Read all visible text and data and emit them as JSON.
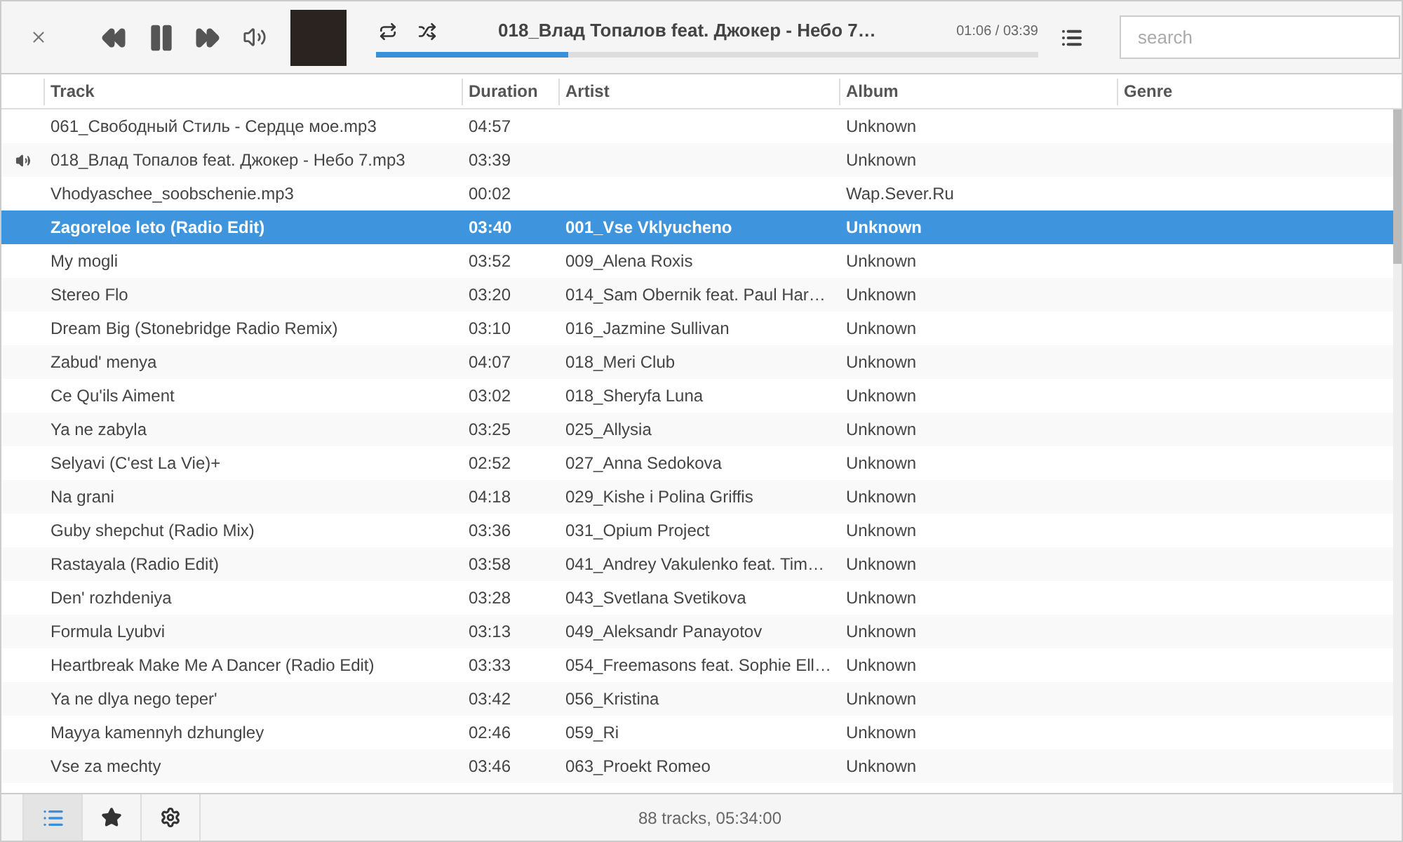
{
  "player": {
    "now_playing": "018_Влад Топалов feat. Джокер - Небо 7…",
    "time": "01:06 / 03:39",
    "level": 0.29,
    "search": {
      "placeholder": "search"
    }
  },
  "table": {
    "columns": [
      "Track",
      "Duration",
      "Artist",
      "Album",
      "Genre"
    ],
    "rows": [
      {
        "track": "061_Свободный Стиль - Сердце мое.mp3",
        "duration": "04:57",
        "artist": "",
        "album": "Unknown",
        "playing": false,
        "selected": false
      },
      {
        "track": "018_Влад Топалов feat. Джокер - Небо 7.mp3",
        "duration": "03:39",
        "artist": "",
        "album": "Unknown",
        "playing": true,
        "selected": false
      },
      {
        "track": "Vhodyaschee_soobschenie.mp3",
        "duration": "00:02",
        "artist": "",
        "album": "Wap.Sever.Ru",
        "playing": false,
        "selected": false
      },
      {
        "track": "Zagoreloe leto (Radio Edit)",
        "duration": "03:40",
        "artist": "001_Vse Vklyucheno",
        "album": "Unknown",
        "playing": false,
        "selected": true
      },
      {
        "track": "My mogli",
        "duration": "03:52",
        "artist": "009_Alena Roxis",
        "album": "Unknown",
        "playing": false,
        "selected": false
      },
      {
        "track": "Stereo Flo",
        "duration": "03:20",
        "artist": "014_Sam Obernik feat. Paul Har…",
        "album": "Unknown",
        "playing": false,
        "selected": false
      },
      {
        "track": "Dream Big (Stonebridge Radio Remix)",
        "duration": "03:10",
        "artist": "016_Jazmine Sullivan",
        "album": "Unknown",
        "playing": false,
        "selected": false
      },
      {
        "track": "Zabud' menya",
        "duration": "04:07",
        "artist": "018_Meri Club",
        "album": "Unknown",
        "playing": false,
        "selected": false
      },
      {
        "track": "Ce Qu'ils Aiment",
        "duration": "03:02",
        "artist": "018_Sheryfa Luna",
        "album": "Unknown",
        "playing": false,
        "selected": false
      },
      {
        "track": "Ya ne zabyla",
        "duration": "03:25",
        "artist": "025_Allysia",
        "album": "Unknown",
        "playing": false,
        "selected": false
      },
      {
        "track": "Selyavi (C'est La Vie)+",
        "duration": "02:52",
        "artist": "027_Anna Sedokova",
        "album": "Unknown",
        "playing": false,
        "selected": false
      },
      {
        "track": "Na grani",
        "duration": "04:18",
        "artist": "029_Kishe i Polina Griffis",
        "album": "Unknown",
        "playing": false,
        "selected": false
      },
      {
        "track": "Guby shepchut (Radio Mix)",
        "duration": "03:36",
        "artist": "031_Opium Project",
        "album": "Unknown",
        "playing": false,
        "selected": false
      },
      {
        "track": "Rastayala (Radio Edit)",
        "duration": "03:58",
        "artist": "041_Andrey Vakulenko feat. Tim…",
        "album": "Unknown",
        "playing": false,
        "selected": false
      },
      {
        "track": "Den' rozhdeniya",
        "duration": "03:28",
        "artist": "043_Svetlana Svetikova",
        "album": "Unknown",
        "playing": false,
        "selected": false
      },
      {
        "track": "Formula Lyubvi",
        "duration": "03:13",
        "artist": "049_Aleksandr Panayotov",
        "album": "Unknown",
        "playing": false,
        "selected": false
      },
      {
        "track": "Heartbreak Make Me A Dancer (Radio Edit)",
        "duration": "03:33",
        "artist": "054_Freemasons feat. Sophie Ell…",
        "album": "Unknown",
        "playing": false,
        "selected": false
      },
      {
        "track": "Ya ne dlya nego teper'",
        "duration": "03:42",
        "artist": "056_Kristina",
        "album": "Unknown",
        "playing": false,
        "selected": false
      },
      {
        "track": "Mayya kamennyh dzhungley",
        "duration": "02:46",
        "artist": "059_Ri",
        "album": "Unknown",
        "playing": false,
        "selected": false
      },
      {
        "track": "Vse za mechty",
        "duration": "03:46",
        "artist": "063_Proekt Romeo",
        "album": "Unknown",
        "playing": false,
        "selected": false
      }
    ]
  },
  "footer": {
    "tabs": [
      {
        "kind": "list",
        "selected": true
      },
      {
        "kind": "star",
        "selected": false
      },
      {
        "kind": "gear",
        "selected": false
      }
    ],
    "status": "88 tracks, 05:34:00"
  }
}
